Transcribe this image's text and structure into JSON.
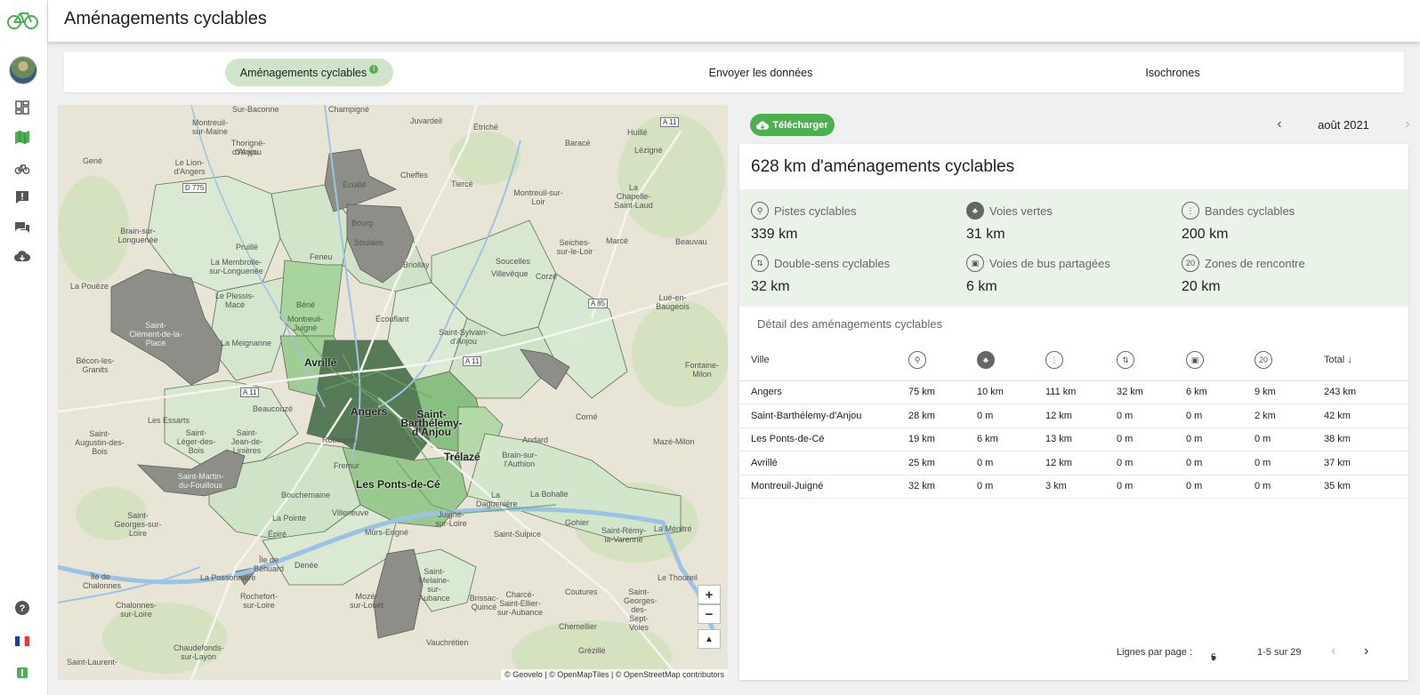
{
  "app": {
    "title": "Aménagements cyclables",
    "logo_icon": "bicycle-logo-icon",
    "accent_color": "#4caf50"
  },
  "sidebar": {
    "items": [
      {
        "name": "dashboard-icon"
      },
      {
        "name": "map-icon"
      },
      {
        "name": "bicycle-icon"
      },
      {
        "name": "report-icon"
      },
      {
        "name": "chat-icon"
      },
      {
        "name": "cloud-download-icon"
      }
    ],
    "bottom": [
      {
        "name": "help-icon"
      },
      {
        "name": "french-flag-icon"
      },
      {
        "name": "app-badge-icon"
      }
    ]
  },
  "tabs": [
    {
      "label": "Aménagements cyclables",
      "active": true
    },
    {
      "label": "Envoyer les données",
      "active": false
    },
    {
      "label": "Isochrones",
      "active": false
    }
  ],
  "map": {
    "city_labels": {
      "angers": "Angers",
      "avrille": "Avrillé",
      "saint_barthelemy": "Saint-Barthélemy-d'Anjou",
      "trelaze": "Trélazé",
      "les_ponts": "Les Ponts-de-Cé"
    },
    "place_labels": [
      "Écuillé",
      "Bourg",
      "Soulaire",
      "Feneu",
      "Cheffes",
      "Tiercé",
      "Briollay",
      "Soucelles",
      "Villevêque",
      "Corzé",
      "Montreuil-sur-Loir",
      "Seiches-sur-le-Loir",
      "Marcé",
      "Beauvau",
      "Lué-en-Baugeois",
      "Béné",
      "Montreuil-Juigné",
      "Écouflant",
      "Saint-Sylvain-d'Anjou",
      "La Membrolle-sur-Longuenée",
      "Le Plessis-Macé",
      "La Meignanne",
      "Saint-Clément-de-la-Place",
      "Bécon-les-Granits",
      "Beaucouzé",
      "Les Essarts",
      "Saint-Léger-des-Bois",
      "Saint-Jean-de-Linières",
      "Saint-Augustin-des-Bois",
      "Saint-Martin-du-Fouilloux",
      "Bouchemaine",
      "Fremur",
      "Robinson",
      "Andard",
      "Brain-sur-l'Authion",
      "Corné",
      "Mazé-Milon",
      "La Daguenière",
      "La Bohalle",
      "Juigné-sur-Loire",
      "Mûrs-Erigné",
      "Saint-Sulpice",
      "Gohier",
      "Saint-Rémy-la-Varenne",
      "La Ménitré",
      "Saint-Melaine-sur-Aubance",
      "Brissac-Quincé",
      "Charcé-Saint-Ellier-sur-Aubance",
      "Coutures",
      "Saint-Georges-des-Sept-Voies",
      "Le Thoureil",
      "Chemellier",
      "Grézillé",
      "Vauchrétien",
      "Mozé-sur-Louet",
      "Rochefort-sur-Loire",
      "La Possonnière",
      "Denée",
      "Île de Béhuard",
      "Villeneuve",
      "La Pointe",
      "Épiré",
      "Saint-Georges-sur-Loire",
      "Chalonnes-sur-Loire",
      "Chaudefonds-sur-Layon",
      "Saint-Laurent-",
      "Île de Chalonnes",
      "Pruillé",
      "Brain-sur-Longuenée",
      "La Pouëze",
      "Gené",
      "Le Lion-d'Angers",
      "Montreuil-sur-Maine",
      "Thorigné-d'Anjou",
      "Juvardeil",
      "Étriché",
      "Champigné",
      "Baracé",
      "Huillé",
      "Lézigné",
      "La Chapelle-Saint-Laud",
      "Fontaine-Milon",
      "Sur-Baconne",
      "d'Anjou"
    ],
    "road_labels": [
      "A 11",
      "D 775",
      "A 85",
      "A 11",
      "A 11"
    ],
    "attribution": "© Geovelo | © OpenMapTiles | © OpenStreetMap contributors",
    "zoom_in": "+",
    "zoom_out": "−",
    "north": "▲"
  },
  "toolbar": {
    "download_label": "Télécharger",
    "month": "août 2021"
  },
  "summary": {
    "heading": "628 km d'aménagements cyclables",
    "stats": [
      {
        "icon": "bike-path-icon",
        "label": "Pistes cyclables",
        "value": "339 km"
      },
      {
        "icon": "tree-icon",
        "label": "Voies vertes",
        "value": "31 km"
      },
      {
        "icon": "bike-lane-icon",
        "label": "Bandes cyclables",
        "value": "200 km"
      },
      {
        "icon": "contraflow-icon",
        "label": "Double-sens cyclables",
        "value": "32 km"
      },
      {
        "icon": "bus-icon",
        "label": "Voies de bus partagées",
        "value": "6 km"
      },
      {
        "icon": "zone-20-icon",
        "label": "Zones de rencontre",
        "value": "20 km"
      }
    ]
  },
  "table": {
    "subheading": "Détail des aménagements cyclables",
    "columns": [
      "Ville",
      "",
      "",
      "",
      "",
      "",
      "",
      "Total"
    ],
    "rows": [
      [
        "Angers",
        "75 km",
        "10 km",
        "111 km",
        "32 km",
        "6 km",
        "9 km",
        "243 km"
      ],
      [
        "Saint-Barthélemy-d'Anjou",
        "28 km",
        "0 m",
        "12 km",
        "0 m",
        "0 m",
        "2 km",
        "42 km"
      ],
      [
        "Les Ponts-de-Cé",
        "19 km",
        "6 km",
        "13 km",
        "0 m",
        "0 m",
        "0 m",
        "38 km"
      ],
      [
        "Avrillé",
        "25 km",
        "0 m",
        "12 km",
        "0 m",
        "0 m",
        "0 m",
        "37 km"
      ],
      [
        "Montreuil-Juigné",
        "32 km",
        "0 m",
        "3 km",
        "0 m",
        "0 m",
        "0 m",
        "35 km"
      ]
    ],
    "rows_per_page_label": "Lignes par page :",
    "rows_per_page": "5",
    "range": "1-5 sur 29"
  }
}
